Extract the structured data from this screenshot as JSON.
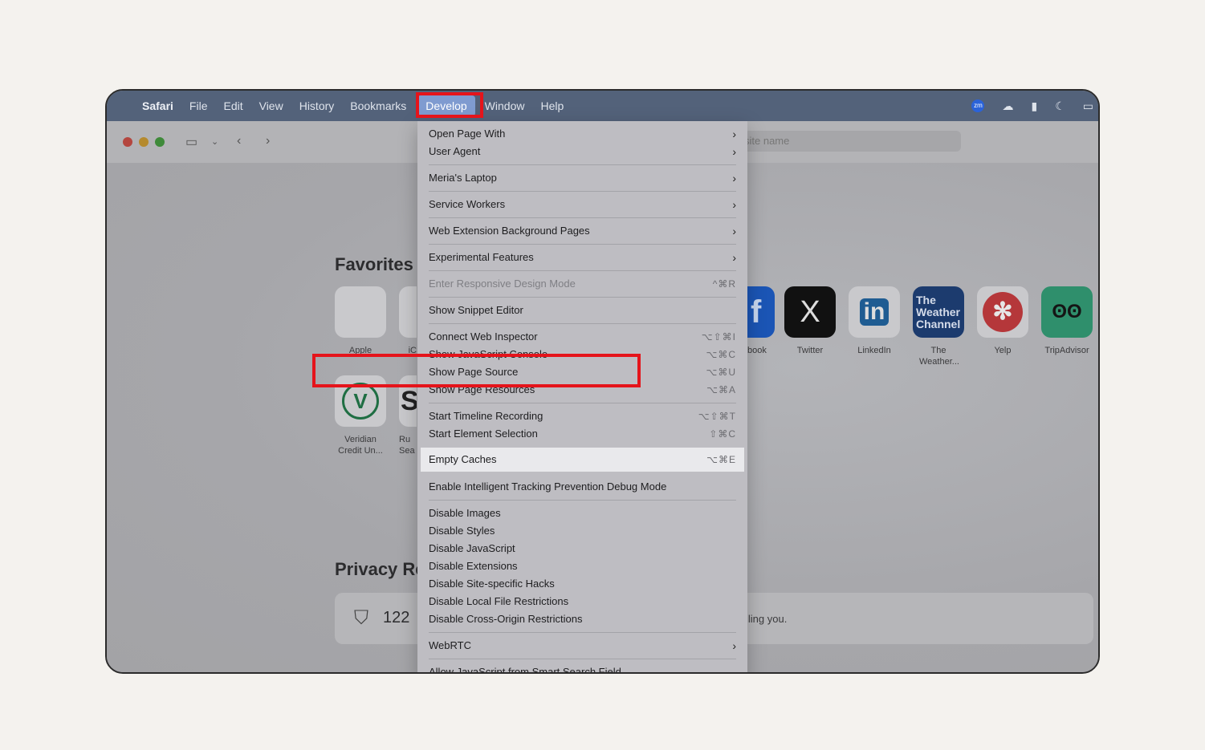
{
  "menubar": {
    "items": [
      "Safari",
      "File",
      "Edit",
      "View",
      "History",
      "Bookmarks",
      "Develop",
      "Window",
      "Help"
    ],
    "status_icons": [
      "zoom-icon",
      "wifi-cloud-icon",
      "bookmark-icon",
      "moon-icon",
      "battery-icon"
    ],
    "zoom_label": "zm"
  },
  "toolbar": {
    "address_placeholder": "site name"
  },
  "favorites": {
    "title": "Favorites",
    "row1": [
      {
        "label": "Apple",
        "glyph": ""
      },
      {
        "label": "iC",
        "glyph": ""
      },
      {
        "label": "book",
        "glyph": "f"
      },
      {
        "label": "Twitter",
        "glyph": "X"
      },
      {
        "label": "LinkedIn",
        "glyph": "in"
      },
      {
        "label": "The Weather...",
        "glyph": "The Weather Channel"
      },
      {
        "label": "Yelp",
        "glyph": "✻"
      },
      {
        "label": "TripAdvisor",
        "glyph": "ʘʘ"
      }
    ],
    "row2": [
      {
        "label": "Veridian Credit Un...",
        "glyph": "V"
      },
      {
        "label": "Ru Sea",
        "glyph": "S"
      }
    ]
  },
  "privacy": {
    "title": "Privacy Re",
    "count": "122",
    "text": "iling you."
  },
  "develop_menu": {
    "open_page_with": "Open Page With",
    "user_agent": "User Agent",
    "laptop": "Meria's Laptop",
    "service_workers": "Service Workers",
    "web_extension": "Web Extension Background Pages",
    "experimental": "Experimental Features",
    "responsive": {
      "label": "Enter Responsive Design Mode",
      "shortcut": "^⌘R"
    },
    "snippet": "Show Snippet Editor",
    "connect_inspector": {
      "label": "Connect Web Inspector",
      "shortcut": "⌥⇧⌘I"
    },
    "js_console": {
      "label": "Show JavaScript Console",
      "shortcut": "⌥⌘C"
    },
    "page_source": {
      "label": "Show Page Source",
      "shortcut": "⌥⌘U"
    },
    "page_resources": {
      "label": "Show Page Resources",
      "shortcut": "⌥⌘A"
    },
    "timeline": {
      "label": "Start Timeline Recording",
      "shortcut": "⌥⇧⌘T"
    },
    "element_selection": {
      "label": "Start Element Selection",
      "shortcut": "⇧⌘C"
    },
    "empty_caches": {
      "label": "Empty Caches",
      "shortcut": "⌥⌘E"
    },
    "itp_debug": "Enable Intelligent Tracking Prevention Debug Mode",
    "disable_images": "Disable Images",
    "disable_styles": "Disable Styles",
    "disable_js": "Disable JavaScript",
    "disable_extensions": "Disable Extensions",
    "disable_hacks": "Disable Site-specific Hacks",
    "disable_local": "Disable Local File Restrictions",
    "disable_cors": "Disable Cross-Origin Restrictions",
    "webrtc": "WebRTC",
    "allow_js": "Allow JavaScript from Smart Search Field"
  }
}
